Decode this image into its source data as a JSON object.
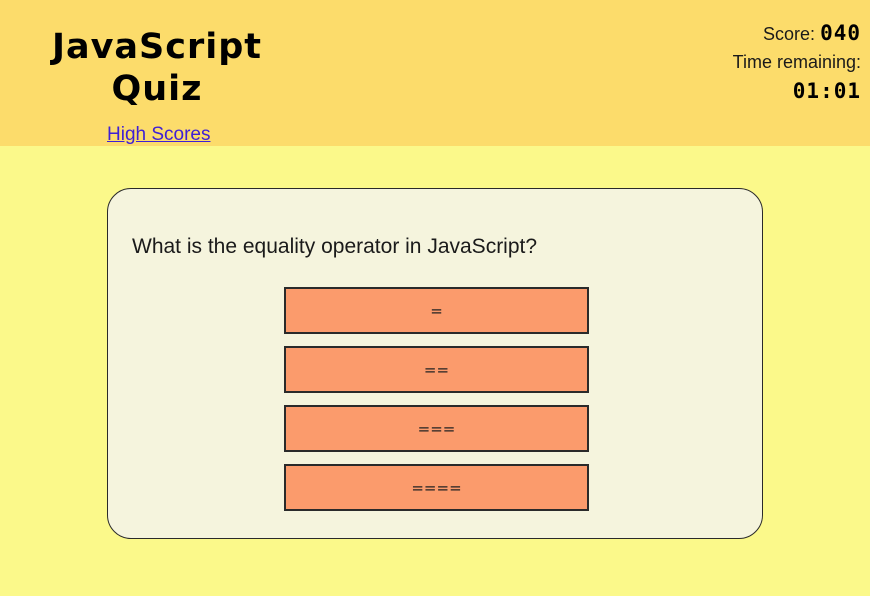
{
  "header": {
    "title": "JavaScript Quiz",
    "high_scores_link": "High Scores"
  },
  "stats": {
    "score_label": "Score:",
    "score_value": "040",
    "time_label": "Time remaining:",
    "time_value": "01:01"
  },
  "quiz": {
    "question": "What is the equality operator in JavaScript?",
    "answers": [
      "=",
      "==",
      "===",
      "===="
    ]
  },
  "colors": {
    "header_bg": "#fcdc6b",
    "page_bg": "#fbf98a",
    "card_bg": "#f5f4dd",
    "answer_bg": "#fb9b6c",
    "link": "#3e1fd6"
  }
}
